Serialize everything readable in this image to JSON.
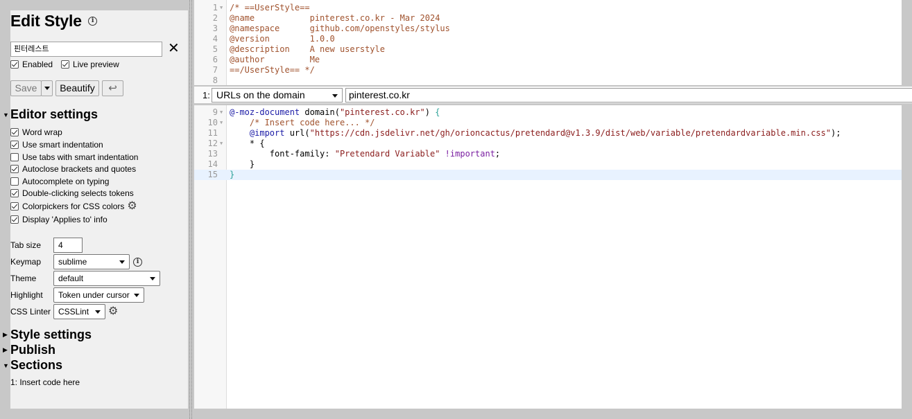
{
  "header": {
    "title": "Edit Style",
    "info_icon": "info-circle-icon"
  },
  "style_name": {
    "value": "핀터레스트"
  },
  "toggles": {
    "enabled": "Enabled",
    "live_preview": "Live preview"
  },
  "actions": {
    "save": "Save",
    "beautify": "Beautify",
    "undo_icon": "↩"
  },
  "editor_settings": {
    "heading": "Editor settings",
    "options": [
      {
        "label": "Word wrap",
        "checked": true
      },
      {
        "label": "Use smart indentation",
        "checked": true
      },
      {
        "label": "Use tabs with smart indentation",
        "checked": false
      },
      {
        "label": "Autoclose brackets and quotes",
        "checked": true
      },
      {
        "label": "Autocomplete on typing",
        "checked": false
      },
      {
        "label": "Double-clicking selects tokens",
        "checked": true
      },
      {
        "label": "Colorpickers for CSS colors",
        "checked": true
      },
      {
        "label": "Display 'Applies to' info",
        "checked": true
      }
    ],
    "tab_size": {
      "label": "Tab size",
      "value": "4"
    },
    "keymap": {
      "label": "Keymap",
      "value": "sublime"
    },
    "theme": {
      "label": "Theme",
      "value": "default"
    },
    "highlight": {
      "label": "Highlight",
      "value": "Token under cursor"
    },
    "linter": {
      "label": "CSS Linter",
      "value": "CSSLint"
    }
  },
  "panels": {
    "style_settings": "Style settings",
    "publish": "Publish",
    "sections": "Sections"
  },
  "section_list": [
    "1: Insert code here"
  ],
  "meta_code": [
    "/* ==UserStyle==",
    "@name           pinterest.co.kr - Mar 2024",
    "@namespace      github.com/openstyles/stylus",
    "@version        1.0.0",
    "@description    A new userstyle",
    "@author         Me",
    "==/UserStyle== */",
    ""
  ],
  "applies_to": {
    "index": "1:",
    "type": "URLs on the domain",
    "value": "pinterest.co.kr"
  },
  "section_code": {
    "l9a": "@-moz-document",
    "l9b": " domain(",
    "l9c": "\"pinterest.co.kr\"",
    "l9d": ") ",
    "l9e": "{",
    "l10": "    /* Insert code here... */",
    "l11a": "    ",
    "l11b": "@import",
    "l11c": " url(",
    "l11d": "\"https://cdn.jsdelivr.net/gh/orioncactus/pretendard@v1.3.9/dist/web/variable/pretendardvariable.min.css\"",
    "l11e": ");",
    "l12": "    * {",
    "l13a": "        font-family: ",
    "l13b": "\"Pretendard Variable\"",
    "l13c": " ",
    "l13d": "!important",
    "l13e": ";",
    "l14": "    }",
    "l15": "}"
  },
  "line_numbers": [
    "1",
    "2",
    "3",
    "4",
    "5",
    "6",
    "7",
    "8",
    "9",
    "10",
    "11",
    "12",
    "13",
    "14",
    "15"
  ],
  "colors": {
    "comment": "#a0522d",
    "keyword": "#7a1ea1",
    "string": "#8a1c1c",
    "bracket": "#2aa198"
  }
}
